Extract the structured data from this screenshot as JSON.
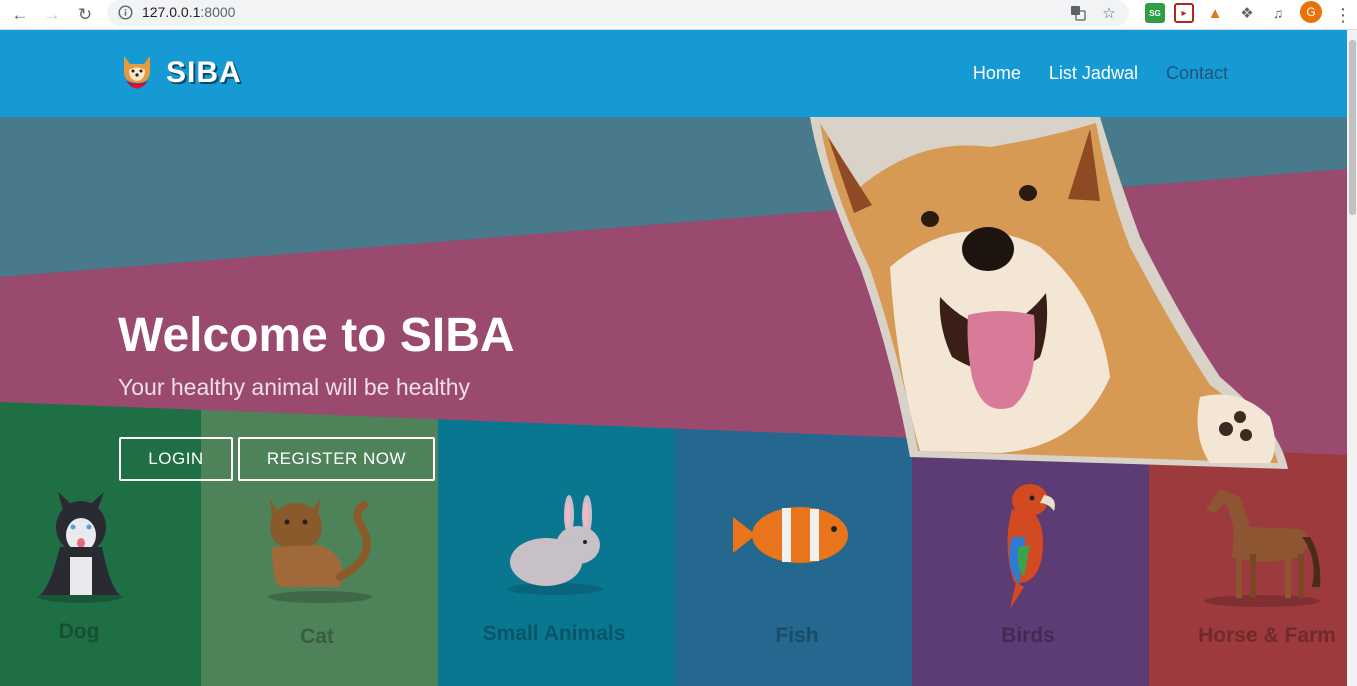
{
  "browser": {
    "url_host": "127.0.0.1",
    "url_port": ":8000",
    "avatar_letter": "G",
    "ext_badge": "SG"
  },
  "site": {
    "brand": "SIBA",
    "nav": [
      {
        "label": "Home"
      },
      {
        "label": "List Jadwal"
      },
      {
        "label": "Contact"
      }
    ]
  },
  "hero": {
    "title": "Welcome to SIBA",
    "subtitle": "Your healthy animal will be healthy",
    "login_label": "LOGIN",
    "register_label": "REGISTER NOW"
  },
  "categories": [
    {
      "label": "Dog",
      "color": "#1f6f45"
    },
    {
      "label": "Cat",
      "color": "#4e8259"
    },
    {
      "label": "Small Animals",
      "color": "#0a7791"
    },
    {
      "label": "Fish",
      "color": "#24688f"
    },
    {
      "label": "Birds",
      "color": "#5b3c74"
    },
    {
      "label": "Horse & Farm",
      "color": "#9c3a3d"
    }
  ],
  "colors": {
    "header": "#159ad3",
    "band": "#9a4a6f",
    "sky": "#487a8c"
  }
}
